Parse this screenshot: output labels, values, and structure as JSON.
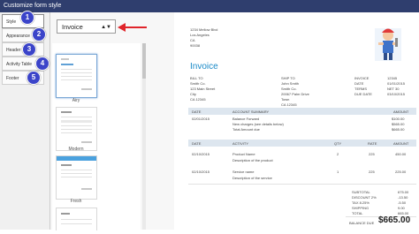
{
  "window": {
    "title": "Customize form style"
  },
  "nav": {
    "items": [
      {
        "label": "Style",
        "badge": "1"
      },
      {
        "label": "Appearance",
        "badge": "2"
      },
      {
        "label": "Header",
        "badge": "3"
      },
      {
        "label": "Activity Table",
        "badge": "4"
      },
      {
        "label": "Footer",
        "badge": "5"
      }
    ]
  },
  "form_type": {
    "selected": "Invoice"
  },
  "presets": [
    {
      "name": "Airy"
    },
    {
      "name": "Modern"
    },
    {
      "name": "Fresh"
    }
  ],
  "invoice": {
    "from": [
      "1234 Mellow Blvd",
      "Los Angeles",
      "CA",
      "90038"
    ],
    "title": "Invoice",
    "bill_to": {
      "label": "BILL TO",
      "lines": [
        "Smith Co.",
        "123 Main Street",
        "City",
        "CA 12345"
      ]
    },
    "ship_to": {
      "label": "SHIP TO",
      "lines": [
        "John Smith",
        "Smith Co.",
        "20067 Palm Drive",
        "Town",
        "CA 12345"
      ]
    },
    "meta": [
      {
        "label": "INVOICE",
        "value": "12345"
      },
      {
        "label": "DATE",
        "value": "01/01/2015"
      },
      {
        "label": "TERMS",
        "value": "NET 30"
      },
      {
        "label": "DUE DATE",
        "value": "03/10/2015"
      }
    ],
    "summary_table": {
      "headers": [
        "DATE",
        "ACCOUNT SUMMARY",
        "AMOUNT"
      ],
      "rows": [
        {
          "date": "02/01/2015",
          "desc": "Balance Forward",
          "amount": "$100.00"
        },
        {
          "date": "",
          "desc": "New charges (see details below)",
          "amount": "$565.00"
        },
        {
          "date": "",
          "desc": "Total Amount due",
          "amount": "$665.00"
        }
      ]
    },
    "activity_table": {
      "headers": [
        "DATE",
        "ACTIVITY",
        "QTY",
        "RATE",
        "AMOUNT"
      ],
      "rows": [
        {
          "date": "02/10/2015",
          "activity": "Product Name",
          "desc": "Description of the product",
          "qty": "2",
          "rate": "225",
          "amount": "450.00"
        },
        {
          "date": "02/10/2015",
          "activity": "Service name",
          "desc": "Description of the service",
          "qty": "1",
          "rate": "225",
          "amount": "225.00"
        }
      ]
    },
    "totals": [
      {
        "label": "SUBTOTAL",
        "value": "675.00"
      },
      {
        "label": "DISCOUNT 2%",
        "value": "-13.50"
      },
      {
        "label": "TAX 8.25%",
        "value": "-5.50"
      },
      {
        "label": "SHIPPING",
        "value": "9.00"
      },
      {
        "label": "TOTAL",
        "value": "665.00"
      }
    ],
    "balance_due": {
      "label": "BALANCE DUE",
      "value": "$665.00"
    }
  }
}
